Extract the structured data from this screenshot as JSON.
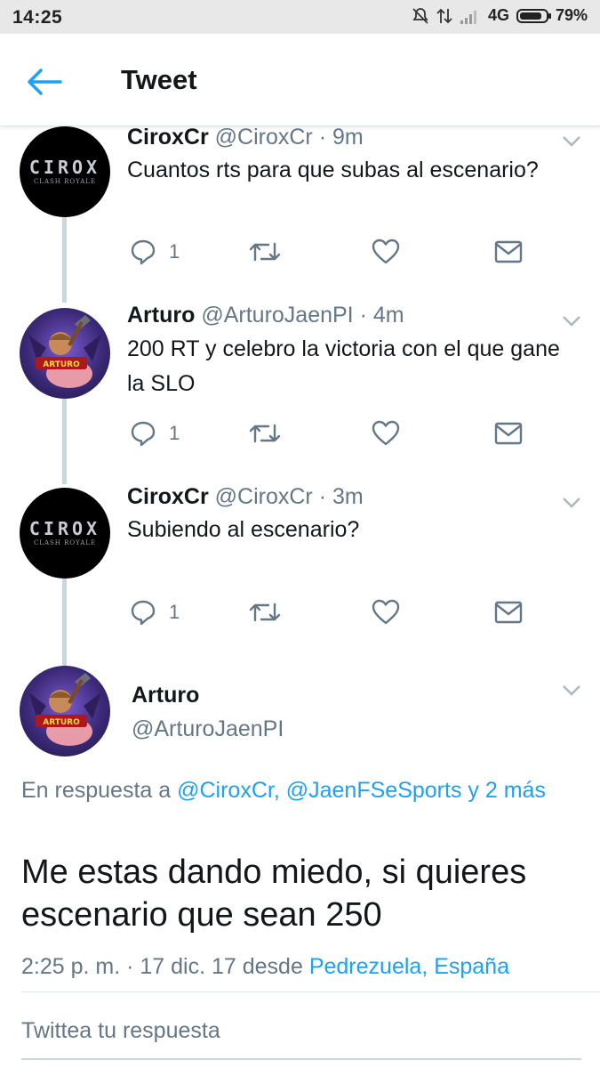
{
  "status_bar": {
    "time": "14:25",
    "network": "4G",
    "battery": "79%"
  },
  "header": {
    "title": "Tweet"
  },
  "tweets": [
    {
      "name": "CiroxCr",
      "handle": "@CiroxCr",
      "separator": "·",
      "time": "9m",
      "text": "Cuantos rts para que subas al escenario?",
      "reply_count": "1",
      "avatar_text": "CIROX",
      "avatar_subtext": "CLASH ROYALE"
    },
    {
      "name": "Arturo",
      "handle": "@ArturoJaenPI",
      "separator": "·",
      "time": "4m",
      "text": "200 RT y celebro la victoria con el que gane la SLO",
      "reply_count": "1",
      "avatar_text": "ARTURO"
    },
    {
      "name": "CiroxCr",
      "handle": "@CiroxCr",
      "separator": "·",
      "time": "3m",
      "text": "Subiendo al escenario?",
      "reply_count": "1",
      "avatar_text": "CIROX",
      "avatar_subtext": "CLASH ROYALE"
    }
  ],
  "focused_tweet": {
    "name": "Arturo",
    "handle": "@ArturoJaenPI",
    "avatar_text": "ARTURO",
    "in_reply_prefix": "En respuesta a",
    "in_reply_mention_1": "@CiroxCr,",
    "in_reply_mention_2": "@JaenFSeSports",
    "in_reply_more": "y 2 más",
    "text": "Me estas dando miedo, si quieres escenario que sean 250",
    "timestamp": "2:25 p. m. · 17 dic. 17",
    "source_prefix": "desde",
    "location": "Pedrezuela, España"
  },
  "reply_input": {
    "placeholder": "Twittea tu respuesta"
  },
  "colors": {
    "accent": "#1da1f2",
    "text": "#14171a",
    "muted": "#657786",
    "thread_line": "#ccd6dd"
  },
  "icons": [
    "back-arrow-icon",
    "reply-icon",
    "retweet-icon",
    "like-icon",
    "direct-message-icon",
    "chevron-down-icon",
    "mute-icon",
    "signal-icon",
    "battery-icon"
  ]
}
